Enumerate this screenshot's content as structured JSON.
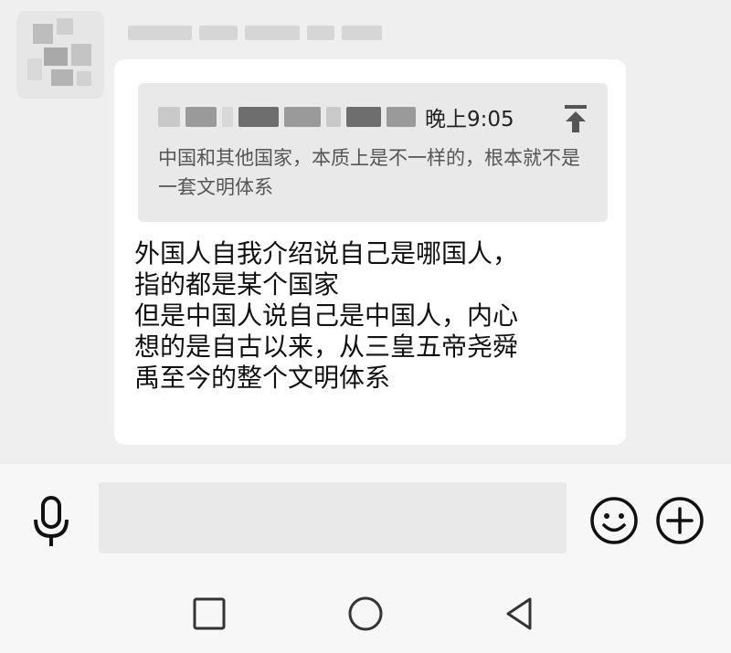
{
  "message": {
    "sender_name_redacted": true,
    "quote": {
      "time": "晚上9:05",
      "text": "中国和其他国家，本质上是不一样的，根本就不是一套文明体系",
      "jump_icon": "arrow-up-to-top-icon"
    },
    "body_lines": [
      "外国人自我介绍说自己是哪国人，",
      "指的都是某个国家",
      "但是中国人说自己是中国人，内心",
      "想的是自古以来，从三皇五帝尧舜",
      "禹至今的整个文明体系"
    ]
  },
  "input_bar": {
    "voice_icon": "microphone-icon",
    "placeholder": "",
    "emoji_icon": "smiley-face-icon",
    "plus_icon": "plus-circle-icon"
  },
  "nav": {
    "recent_icon": "square-icon",
    "home_icon": "circle-icon",
    "back_icon": "triangle-left-icon"
  },
  "colors": {
    "chat_background": "#efefef",
    "bubble": "#ffffff",
    "quote_background": "#e9e9e9",
    "input_background": "#e9e9e9"
  }
}
